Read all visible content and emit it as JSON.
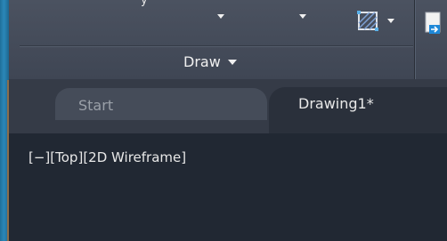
{
  "ribbon": {
    "draw_panel_title": "Draw",
    "partial_label": "y"
  },
  "tabs": [
    {
      "label": "Start",
      "active": false
    },
    {
      "label": "Drawing1*",
      "active": true
    }
  ],
  "viewport": {
    "minimize_control": "[−]",
    "view_control": "[Top]",
    "visual_style_control": "[2D Wireframe]"
  },
  "colors": {
    "ribbon_bg": "#454c59",
    "viewport_bg": "#212833",
    "desktop_accent": "#1f6f9a"
  },
  "icons": [
    "dropdown-arrow-icon",
    "hatch-icon",
    "clipboard-icon"
  ]
}
